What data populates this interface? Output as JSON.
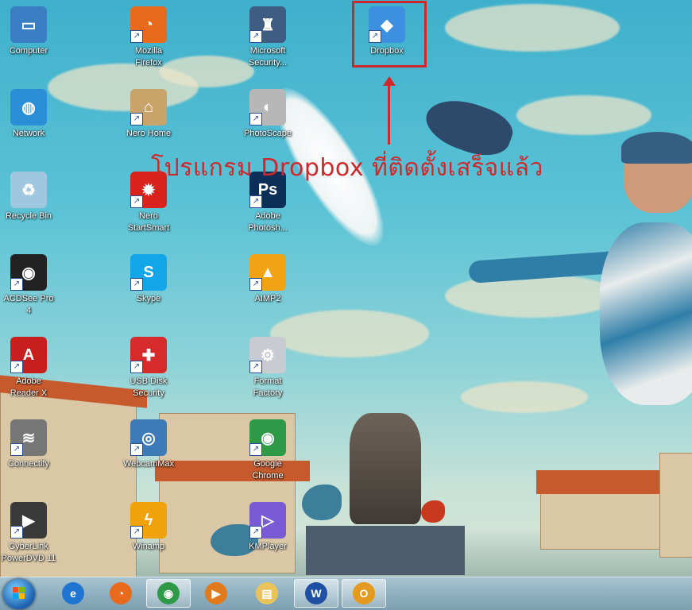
{
  "desktop": {
    "icons": [
      {
        "label": "Computer",
        "icon": "computer-icon",
        "color": "#3a7fc4",
        "glyph": "▭",
        "shortcut": false
      },
      {
        "label": "Network",
        "icon": "network-icon",
        "color": "#2b8fd8",
        "glyph": "◍",
        "shortcut": false
      },
      {
        "label": "Recycle Bin",
        "icon": "recycle-bin-icon",
        "color": "#9fc7df",
        "glyph": "♻",
        "shortcut": false
      },
      {
        "label": "ACDSee Pro\n4",
        "icon": "camera-icon",
        "color": "#222222",
        "glyph": "◉",
        "shortcut": true
      },
      {
        "label": "Adobe\nReader X",
        "icon": "adobe-reader-icon",
        "color": "#c81e1e",
        "glyph": "A",
        "shortcut": true
      },
      {
        "label": "Connectify",
        "icon": "connectify-icon",
        "color": "#777777",
        "glyph": "≋",
        "shortcut": true
      },
      {
        "label": "CyberLink\nPowerDVD 11",
        "icon": "powerdvd-icon",
        "color": "#3a3a3a",
        "glyph": "▶",
        "shortcut": true
      },
      {
        "label": "Mozilla\nFirefox",
        "icon": "firefox-icon",
        "color": "#e86a1c",
        "glyph": "◔",
        "shortcut": true
      },
      {
        "label": "Nero Home",
        "icon": "nero-home-icon",
        "color": "#c9a46a",
        "glyph": "⌂",
        "shortcut": true
      },
      {
        "label": "Nero\nStartSmart",
        "icon": "nero-startsmart-icon",
        "color": "#d8221b",
        "glyph": "✹",
        "shortcut": true
      },
      {
        "label": "Skype",
        "icon": "skype-icon",
        "color": "#12a5e8",
        "glyph": "S",
        "shortcut": true
      },
      {
        "label": "USB Disk\nSecurity",
        "icon": "usb-disk-security-icon",
        "color": "#d72b2b",
        "glyph": "✚",
        "shortcut": true
      },
      {
        "label": "WebcamMax",
        "icon": "webcam-icon",
        "color": "#3d7ab8",
        "glyph": "◎",
        "shortcut": true
      },
      {
        "label": "Winamp",
        "icon": "winamp-icon",
        "color": "#f0a20a",
        "glyph": "ϟ",
        "shortcut": true
      },
      {
        "label": "Microsoft\nSecurity...",
        "icon": "microsoft-security-icon",
        "color": "#3f5d83",
        "glyph": "♜",
        "shortcut": true
      },
      {
        "label": "PhotoScape",
        "icon": "photoscape-icon",
        "color": "#b7b7b7",
        "glyph": "◐",
        "shortcut": true
      },
      {
        "label": "Adobe\nPhotosh...",
        "icon": "photoshop-icon",
        "color": "#0c2f57",
        "glyph": "Ps",
        "shortcut": true
      },
      {
        "label": "AIMP2",
        "icon": "aimp-icon",
        "color": "#f2a314",
        "glyph": "▲",
        "shortcut": true
      },
      {
        "label": "Format\nFactory",
        "icon": "format-factory-icon",
        "color": "#c8ccd2",
        "glyph": "⚙",
        "shortcut": true
      },
      {
        "label": "Google\nChrome",
        "icon": "chrome-icon",
        "color": "#2e9a47",
        "glyph": "◉",
        "shortcut": true
      },
      {
        "label": "KMPlayer",
        "icon": "kmplayer-icon",
        "color": "#7a5bd6",
        "glyph": "▷",
        "shortcut": true
      },
      {
        "label": "Dropbox",
        "icon": "dropbox-icon",
        "color": "#3d8fe0",
        "glyph": "◆",
        "shortcut": true
      }
    ],
    "annotation_text": "โปรแกรม Dropbox ที่ติดตั้งเสร็จแล้ว",
    "highlight_color": "#d0282a"
  },
  "taskbar": {
    "items": [
      {
        "icon": "internet-explorer-icon",
        "color": "#1f74d0",
        "glyph": "e",
        "open": false
      },
      {
        "icon": "firefox-icon",
        "color": "#e86a1c",
        "glyph": "◔",
        "open": false
      },
      {
        "icon": "chrome-icon",
        "color": "#2e9a47",
        "glyph": "◉",
        "open": true
      },
      {
        "icon": "media-player-icon",
        "color": "#e07a1c",
        "glyph": "▶",
        "open": false
      },
      {
        "icon": "windows-explorer-icon",
        "color": "#e8c35a",
        "glyph": "▤",
        "open": false
      },
      {
        "icon": "microsoft-word-icon",
        "color": "#1e4fa3",
        "glyph": "W",
        "open": true
      },
      {
        "icon": "microsoft-outlook-icon",
        "color": "#e39a1e",
        "glyph": "O",
        "open": true
      }
    ]
  }
}
